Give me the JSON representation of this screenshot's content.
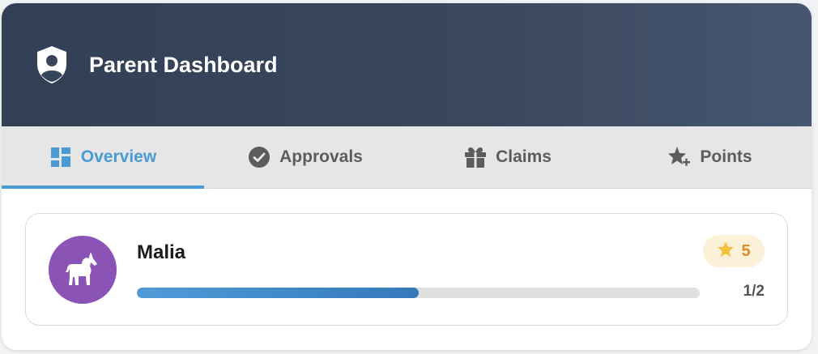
{
  "header": {
    "title": "Parent Dashboard",
    "icon": "shield-user-icon"
  },
  "tabs": [
    {
      "label": "Overview",
      "icon": "dashboard-grid-icon",
      "active": true
    },
    {
      "label": "Approvals",
      "icon": "check-circle-icon",
      "active": false
    },
    {
      "label": "Claims",
      "icon": "gift-icon",
      "active": false
    },
    {
      "label": "Points",
      "icon": "star-plus-icon",
      "active": false
    }
  ],
  "children": [
    {
      "name": "Malia",
      "avatar_icon": "unicorn-icon",
      "avatar_color": "#8b53b6",
      "points": "5",
      "progress_text": "1/2",
      "progress_fraction": 0.5
    }
  ],
  "colors": {
    "accent": "#4a9bd3",
    "header_bg": "#314055",
    "points": "#dd8a2c"
  }
}
